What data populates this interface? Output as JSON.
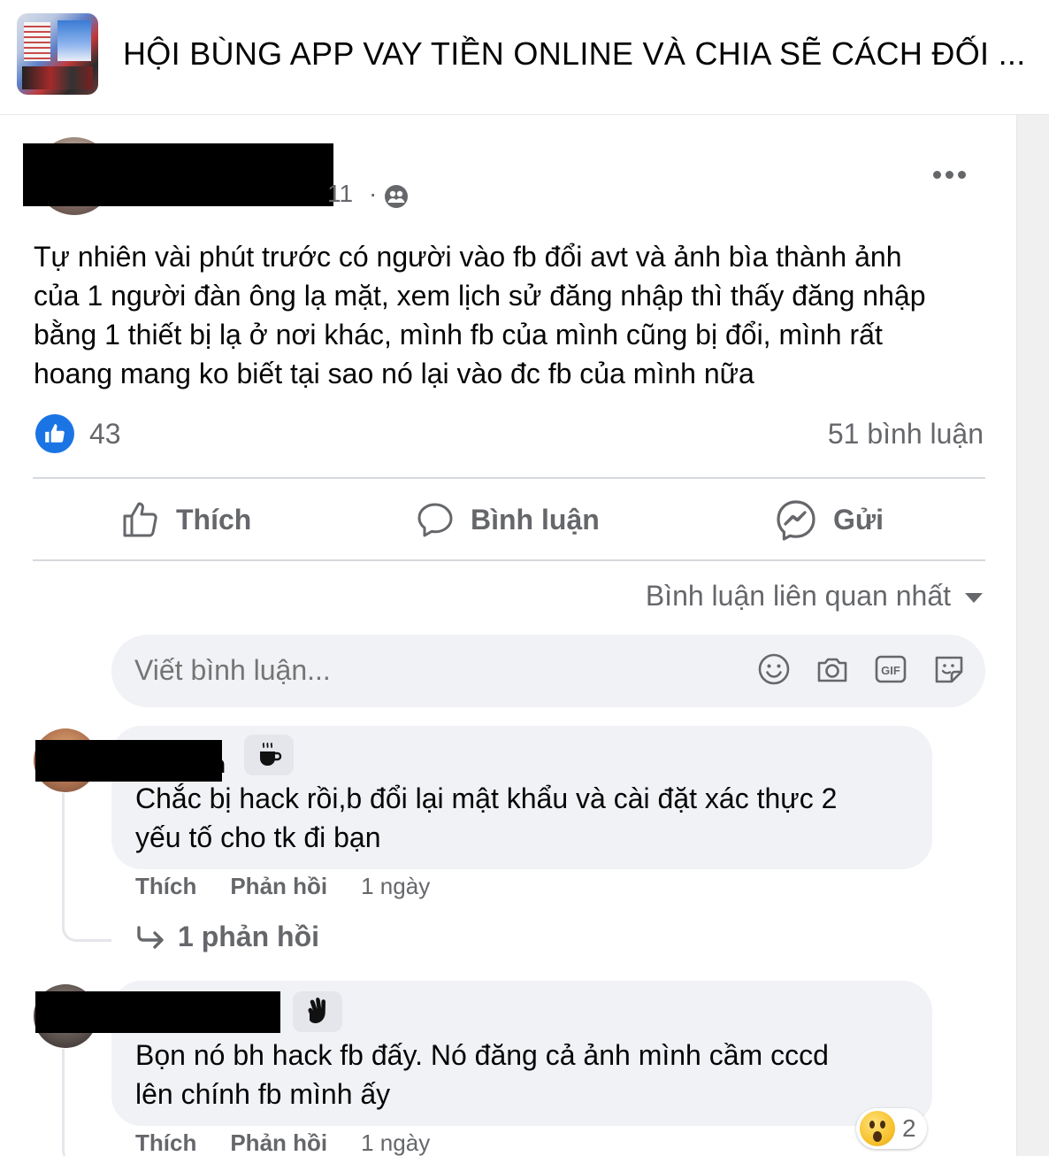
{
  "group": {
    "title": "HỘI BÙNG APP VAY TIỀN ONLINE VÀ CHIA SẼ CÁCH ĐỐI ..."
  },
  "post": {
    "time_fragment": "11",
    "separator": "·",
    "privacy_icon": "friends-icon",
    "text_lines": [
      "Tự nhiên vài phút trước có người vào fb đổi avt và ảnh bìa thành ảnh",
      "của 1 người đàn ông lạ mặt, xem lịch sử đăng nhập thì thấy đăng nhập",
      "bằng 1 thiết bị lạ ở nơi khác, mình fb của mình cũng bị đổi, mình rất",
      "hoang mang ko biết tại sao nó lại vào đc fb của mình nữa"
    ],
    "like_count": "43",
    "comment_count": "51 bình luận",
    "reaction_icon": "like-icon",
    "accent_color": "#1b74e4"
  },
  "actions": {
    "like": "Thích",
    "comment": "Bình luận",
    "send": "Gửi"
  },
  "sort": {
    "label": "Bình luận liên quan nhất"
  },
  "composer": {
    "placeholder": "Viết bình luận...",
    "tools": [
      "emoji-icon",
      "camera-icon",
      "gif-icon",
      "sticker-icon"
    ]
  },
  "comments": [
    {
      "name_fragment": "n",
      "badge_icon": "coffee-icon",
      "text_lines": [
        "Chắc bị hack rồi,b đổi lại mật khẩu và cài đặt xác thực 2",
        "yếu tố cho tk đi bạn"
      ],
      "like_label": "Thích",
      "reply_label": "Phản hồi",
      "time": "1 ngày",
      "replies": "1 phản hồi"
    },
    {
      "badge_icon": "waving-hand-icon",
      "text_lines": [
        "Bọn nó bh hack fb đấy. Nó đăng cả ảnh mình cầm cccd",
        "lên chính fb mình ấy"
      ],
      "like_label": "Thích",
      "reply_label": "Phản hồi",
      "time": "1 ngày",
      "reaction_icon": "wow-icon",
      "reaction_count": "2"
    }
  ]
}
